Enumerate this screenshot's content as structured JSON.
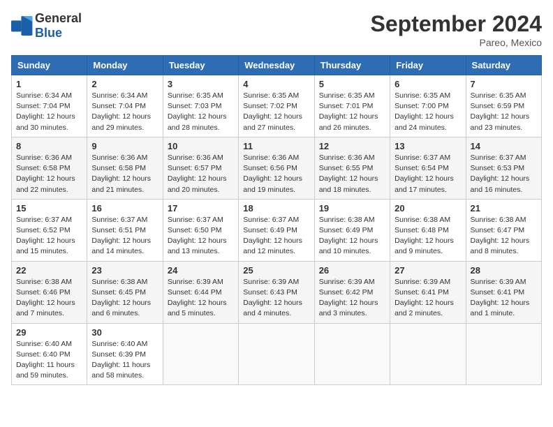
{
  "header": {
    "logo_general": "General",
    "logo_blue": "Blue",
    "month_title": "September 2024",
    "location": "Pareo, Mexico"
  },
  "weekdays": [
    "Sunday",
    "Monday",
    "Tuesday",
    "Wednesday",
    "Thursday",
    "Friday",
    "Saturday"
  ],
  "weeks": [
    [
      {
        "day": "1",
        "info": "Sunrise: 6:34 AM\nSunset: 7:04 PM\nDaylight: 12 hours\nand 30 minutes."
      },
      {
        "day": "2",
        "info": "Sunrise: 6:34 AM\nSunset: 7:04 PM\nDaylight: 12 hours\nand 29 minutes."
      },
      {
        "day": "3",
        "info": "Sunrise: 6:35 AM\nSunset: 7:03 PM\nDaylight: 12 hours\nand 28 minutes."
      },
      {
        "day": "4",
        "info": "Sunrise: 6:35 AM\nSunset: 7:02 PM\nDaylight: 12 hours\nand 27 minutes."
      },
      {
        "day": "5",
        "info": "Sunrise: 6:35 AM\nSunset: 7:01 PM\nDaylight: 12 hours\nand 26 minutes."
      },
      {
        "day": "6",
        "info": "Sunrise: 6:35 AM\nSunset: 7:00 PM\nDaylight: 12 hours\nand 24 minutes."
      },
      {
        "day": "7",
        "info": "Sunrise: 6:35 AM\nSunset: 6:59 PM\nDaylight: 12 hours\nand 23 minutes."
      }
    ],
    [
      {
        "day": "8",
        "info": "Sunrise: 6:36 AM\nSunset: 6:58 PM\nDaylight: 12 hours\nand 22 minutes."
      },
      {
        "day": "9",
        "info": "Sunrise: 6:36 AM\nSunset: 6:58 PM\nDaylight: 12 hours\nand 21 minutes."
      },
      {
        "day": "10",
        "info": "Sunrise: 6:36 AM\nSunset: 6:57 PM\nDaylight: 12 hours\nand 20 minutes."
      },
      {
        "day": "11",
        "info": "Sunrise: 6:36 AM\nSunset: 6:56 PM\nDaylight: 12 hours\nand 19 minutes."
      },
      {
        "day": "12",
        "info": "Sunrise: 6:36 AM\nSunset: 6:55 PM\nDaylight: 12 hours\nand 18 minutes."
      },
      {
        "day": "13",
        "info": "Sunrise: 6:37 AM\nSunset: 6:54 PM\nDaylight: 12 hours\nand 17 minutes."
      },
      {
        "day": "14",
        "info": "Sunrise: 6:37 AM\nSunset: 6:53 PM\nDaylight: 12 hours\nand 16 minutes."
      }
    ],
    [
      {
        "day": "15",
        "info": "Sunrise: 6:37 AM\nSunset: 6:52 PM\nDaylight: 12 hours\nand 15 minutes."
      },
      {
        "day": "16",
        "info": "Sunrise: 6:37 AM\nSunset: 6:51 PM\nDaylight: 12 hours\nand 14 minutes."
      },
      {
        "day": "17",
        "info": "Sunrise: 6:37 AM\nSunset: 6:50 PM\nDaylight: 12 hours\nand 13 minutes."
      },
      {
        "day": "18",
        "info": "Sunrise: 6:37 AM\nSunset: 6:49 PM\nDaylight: 12 hours\nand 12 minutes."
      },
      {
        "day": "19",
        "info": "Sunrise: 6:38 AM\nSunset: 6:49 PM\nDaylight: 12 hours\nand 10 minutes."
      },
      {
        "day": "20",
        "info": "Sunrise: 6:38 AM\nSunset: 6:48 PM\nDaylight: 12 hours\nand 9 minutes."
      },
      {
        "day": "21",
        "info": "Sunrise: 6:38 AM\nSunset: 6:47 PM\nDaylight: 12 hours\nand 8 minutes."
      }
    ],
    [
      {
        "day": "22",
        "info": "Sunrise: 6:38 AM\nSunset: 6:46 PM\nDaylight: 12 hours\nand 7 minutes."
      },
      {
        "day": "23",
        "info": "Sunrise: 6:38 AM\nSunset: 6:45 PM\nDaylight: 12 hours\nand 6 minutes."
      },
      {
        "day": "24",
        "info": "Sunrise: 6:39 AM\nSunset: 6:44 PM\nDaylight: 12 hours\nand 5 minutes."
      },
      {
        "day": "25",
        "info": "Sunrise: 6:39 AM\nSunset: 6:43 PM\nDaylight: 12 hours\nand 4 minutes."
      },
      {
        "day": "26",
        "info": "Sunrise: 6:39 AM\nSunset: 6:42 PM\nDaylight: 12 hours\nand 3 minutes."
      },
      {
        "day": "27",
        "info": "Sunrise: 6:39 AM\nSunset: 6:41 PM\nDaylight: 12 hours\nand 2 minutes."
      },
      {
        "day": "28",
        "info": "Sunrise: 6:39 AM\nSunset: 6:41 PM\nDaylight: 12 hours\nand 1 minute."
      }
    ],
    [
      {
        "day": "29",
        "info": "Sunrise: 6:40 AM\nSunset: 6:40 PM\nDaylight: 11 hours\nand 59 minutes."
      },
      {
        "day": "30",
        "info": "Sunrise: 6:40 AM\nSunset: 6:39 PM\nDaylight: 11 hours\nand 58 minutes."
      },
      {
        "day": "",
        "info": ""
      },
      {
        "day": "",
        "info": ""
      },
      {
        "day": "",
        "info": ""
      },
      {
        "day": "",
        "info": ""
      },
      {
        "day": "",
        "info": ""
      }
    ]
  ]
}
